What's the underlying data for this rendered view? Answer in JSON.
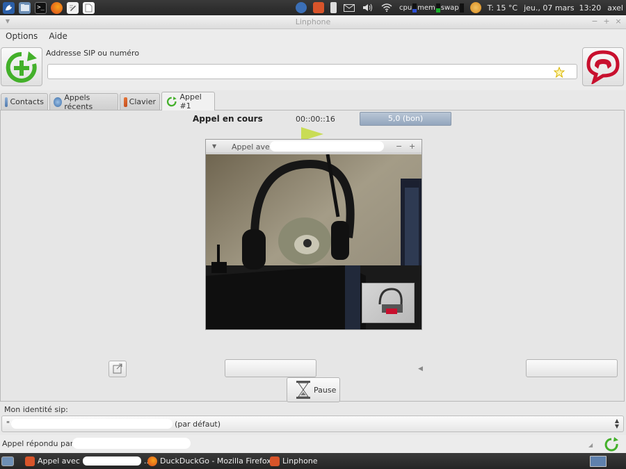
{
  "top_panel": {
    "launchers": [
      "menu-icon",
      "files-icon",
      "terminal-icon",
      "firefox-icon",
      "editor-icon",
      "document-icon"
    ],
    "cpu_label": "cpu",
    "mem_label": "mem",
    "swap_label": "swap",
    "temperature": "T: 15 °C",
    "datetime": "jeu., 07 mars  13:20",
    "user": "axel"
  },
  "window": {
    "title": "Linphone",
    "close": "×",
    "minimize": "−",
    "maximize": "+"
  },
  "menu": {
    "options": "Options",
    "help": "Aide"
  },
  "toolbar": {
    "sip_label": "Addresse SIP ou numéro",
    "sip_value": "",
    "sip_placeholder": ""
  },
  "tabs": [
    {
      "label": "Contacts"
    },
    {
      "label": "Appels récents"
    },
    {
      "label": "Clavier"
    },
    {
      "label": "Appel #1"
    }
  ],
  "call": {
    "status": "Appel en cours",
    "duration": "00::00::16",
    "quality": "5,0 (bon)",
    "video_title": "Appel avec",
    "pause_label": "Pause"
  },
  "identity": {
    "label": "Mon identité sip:",
    "value_prefix": "\"",
    "value_suffix": "(par défaut)"
  },
  "status_bar": {
    "text": "Appel répondu par"
  },
  "taskbar": {
    "items": [
      {
        "label": "Appel avec"
      },
      {
        "label": "DuckDuckGo - Mozilla Firefox"
      },
      {
        "label": "Linphone"
      }
    ],
    "ellipsis": ".."
  },
  "colors": {
    "accent_green": "#43b02a",
    "hangup_red": "#c8102e",
    "quality_bar": "#9fb1c6"
  }
}
